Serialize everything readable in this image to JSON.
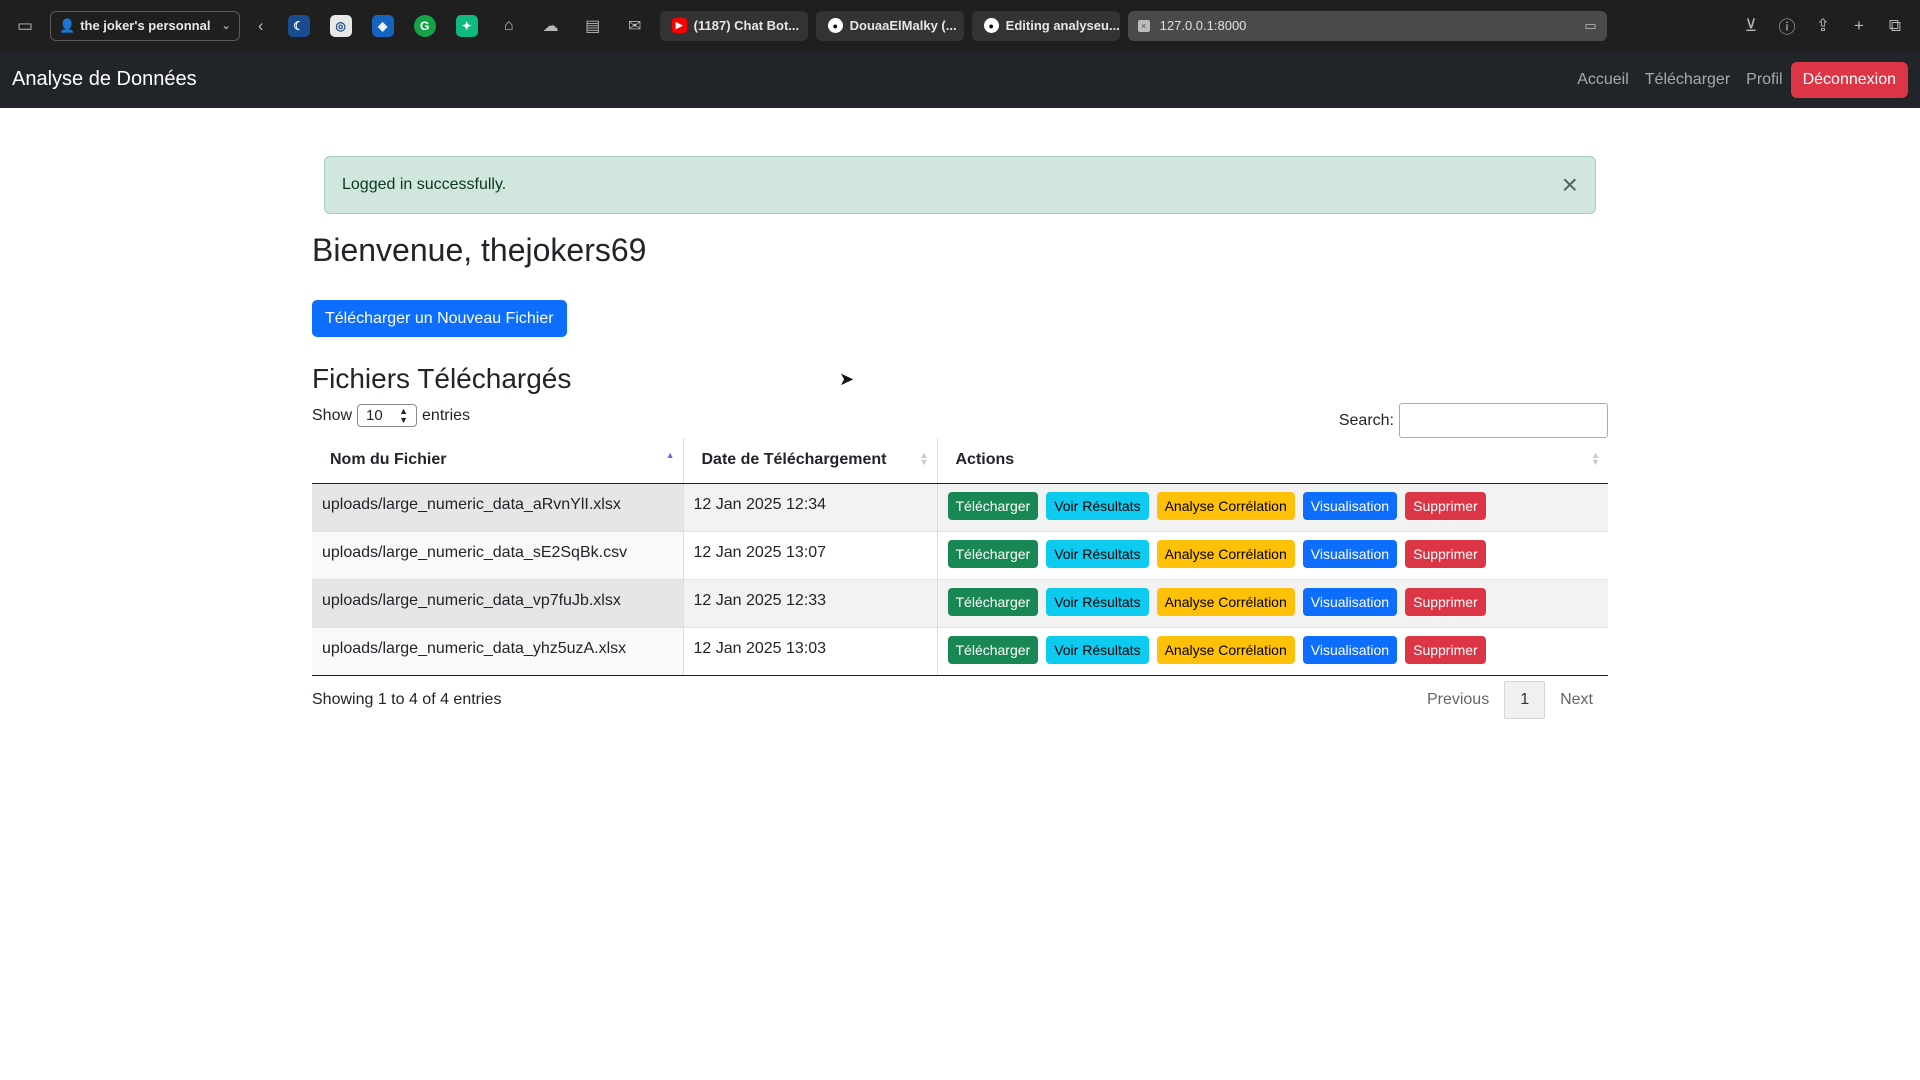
{
  "browser": {
    "profile": "the joker's personnal",
    "tabs": [
      {
        "title": "(1187) Chat Bot...",
        "icon": "youtube-icon",
        "color": "#ff0000"
      },
      {
        "title": "DouaaElMalky (...",
        "icon": "github-icon",
        "color": "#ffffff"
      },
      {
        "title": "Editing analyseu...",
        "icon": "github-icon",
        "color": "#ffffff"
      }
    ],
    "url": "127.0.0.1:8000"
  },
  "navbar": {
    "brand": "Analyse de Données",
    "links": [
      "Accueil",
      "Télécharger",
      "Profil"
    ],
    "logout": "Déconnexion"
  },
  "alert": {
    "message": "Logged in successfully.",
    "close": "×"
  },
  "welcome": "Bienvenue, thejokers69",
  "upload_button": "Télécharger un Nouveau Fichier",
  "files_title": "Fichiers Téléchargés",
  "table_controls": {
    "show": "Show",
    "entries_value": "10",
    "entries": "entries",
    "search_label": "Search:"
  },
  "table": {
    "headers": [
      "Nom du Fichier",
      "Date de Téléchargement",
      "Actions"
    ],
    "action_labels": [
      "Télécharger",
      "Voir Résultats",
      "Analyse Corrélation",
      "Visualisation",
      "Supprimer"
    ],
    "rows": [
      {
        "name": "uploads/large_numeric_data_aRvnYlI.xlsx",
        "date": "12 Jan 2025 12:34"
      },
      {
        "name": "uploads/large_numeric_data_sE2SqBk.csv",
        "date": "12 Jan 2025 13:07"
      },
      {
        "name": "uploads/large_numeric_data_vp7fuJb.xlsx",
        "date": "12 Jan 2025 12:33"
      },
      {
        "name": "uploads/large_numeric_data_yhz5uzA.xlsx",
        "date": "12 Jan 2025 13:03"
      }
    ]
  },
  "footer": {
    "info": "Showing 1 to 4 of 4 entries",
    "previous": "Previous",
    "page": "1",
    "next": "Next"
  }
}
